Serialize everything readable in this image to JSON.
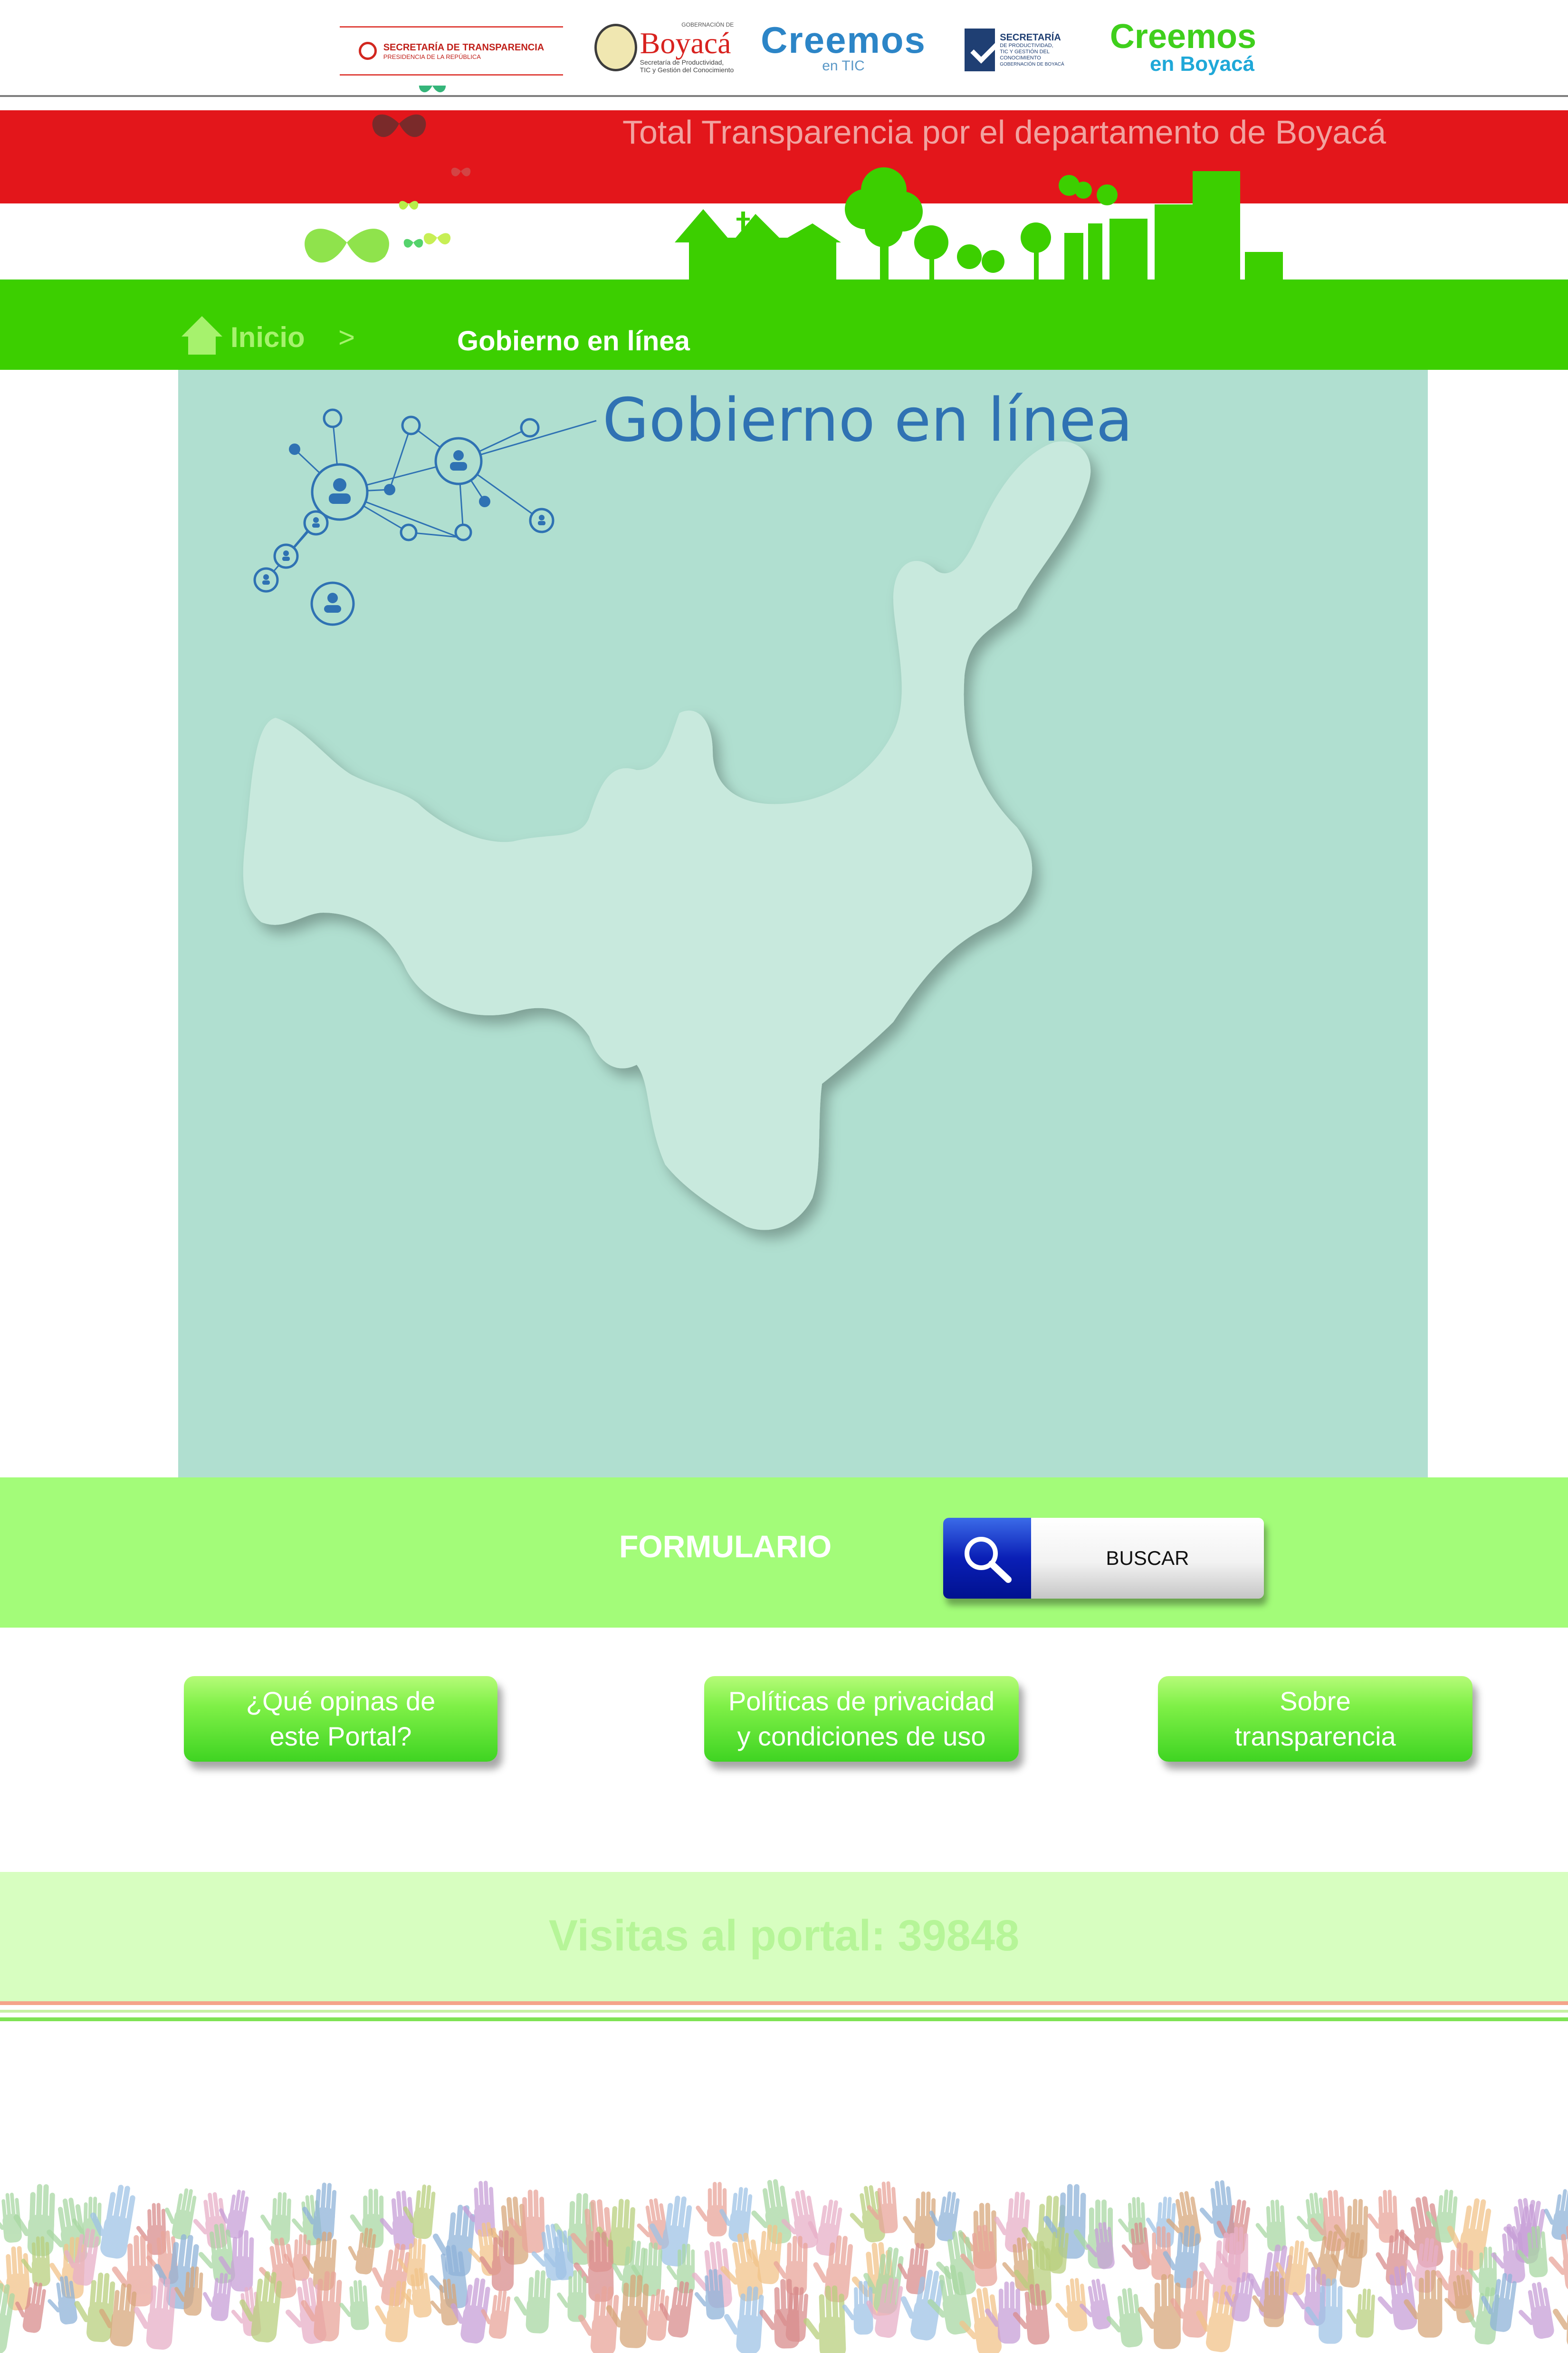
{
  "logos": {
    "secretaria": {
      "title": "SECRETARÍA DE TRANSPARENCIA",
      "subtitle": "PRESIDENCIA DE LA REPÚBLICA"
    },
    "boyaca": {
      "small": "GOBERNACIÓN DE",
      "word": "Boyacá",
      "sub1": "Secretaría de Productividad,",
      "sub2": "TIC y Gestión del Conocimiento"
    },
    "creemos_tic": {
      "word": "Creemos",
      "sub": "en TIC"
    },
    "secretaria_tic": {
      "line1": "SECRETARÍA",
      "line2": "DE PRODUCTIVIDAD,",
      "line3": "TIC Y GESTIÓN DEL CONOCIMIENTO",
      "line4": "GOBERNACIÓN DE BOYACÁ"
    },
    "creemos_boyaca": {
      "word": "Creemos",
      "sub": "en Boyacá"
    }
  },
  "header": {
    "tagline": "Total Transparencia por el departamento de Boyacá",
    "colors": {
      "red": "#e3161b",
      "green": "#3ccf00",
      "accent": "#a6f26d"
    }
  },
  "breadcrumb": {
    "home_icon": "home-icon",
    "home": "Inicio",
    "separator": ">",
    "current": "Gobierno en línea"
  },
  "main": {
    "title": "Gobierno en línea",
    "graphic_icon": "people-network-icon",
    "map_icon": "boyaca-map-silhouette",
    "panel_color": "#b0dfd0"
  },
  "form": {
    "title": "FORMULARIO",
    "search_icon": "search-icon",
    "search_label": "BUSCAR"
  },
  "links": [
    {
      "label": "¿Qué opinas de\neste Portal?"
    },
    {
      "label": "Políticas de privacidad\ny condiciones de uso"
    },
    {
      "label": "Sobre\ntransparencia"
    }
  ],
  "visits": {
    "text": "Visitas al portal: 39848"
  }
}
